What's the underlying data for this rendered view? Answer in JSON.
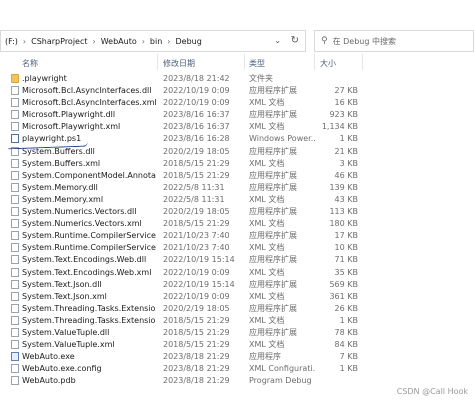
{
  "address_bar": {
    "segments": [
      "(F:)",
      "CSharpProject",
      "WebAuto",
      "bin",
      "Debug"
    ],
    "separator": "›"
  },
  "search": {
    "placeholder": "在 Debug 中搜索"
  },
  "columns": {
    "name": "名称",
    "date": "修改日期",
    "type": "类型",
    "size": "大小"
  },
  "files": [
    {
      "name": ".playwright",
      "date": "2023/8/18 21:42",
      "type": "文件夹",
      "size": "",
      "icon": "folder-icon"
    },
    {
      "name": "Microsoft.Bcl.AsyncInterfaces.dll",
      "date": "2022/10/19 0:09",
      "type": "应用程序扩展",
      "size": "27 KB",
      "icon": "dll-icon"
    },
    {
      "name": "Microsoft.Bcl.AsyncInterfaces.xml",
      "date": "2022/10/19 0:09",
      "type": "XML 文档",
      "size": "16 KB",
      "icon": "xml-icon"
    },
    {
      "name": "Microsoft.Playwright.dll",
      "date": "2023/8/16 16:37",
      "type": "应用程序扩展",
      "size": "923 KB",
      "icon": "dll-icon"
    },
    {
      "name": "Microsoft.Playwright.xml",
      "date": "2023/8/16 16:37",
      "type": "XML 文档",
      "size": "1,134 KB",
      "icon": "xml-icon"
    },
    {
      "name": "playwright.ps1",
      "date": "2023/8/16 16:28",
      "type": "Windows Power...",
      "size": "1 KB",
      "icon": "powershell-icon"
    },
    {
      "name": "System.Buffers.dll",
      "date": "2020/2/19 18:05",
      "type": "应用程序扩展",
      "size": "21 KB",
      "icon": "dll-icon"
    },
    {
      "name": "System.Buffers.xml",
      "date": "2018/5/15 21:29",
      "type": "XML 文档",
      "size": "3 KB",
      "icon": "xml-icon"
    },
    {
      "name": "System.ComponentModel.Annotation...",
      "date": "2018/5/15 21:29",
      "type": "应用程序扩展",
      "size": "46 KB",
      "icon": "dll-icon"
    },
    {
      "name": "System.Memory.dll",
      "date": "2022/5/8 11:31",
      "type": "应用程序扩展",
      "size": "139 KB",
      "icon": "dll-icon"
    },
    {
      "name": "System.Memory.xml",
      "date": "2022/5/8 11:31",
      "type": "XML 文档",
      "size": "43 KB",
      "icon": "xml-icon"
    },
    {
      "name": "System.Numerics.Vectors.dll",
      "date": "2020/2/19 18:05",
      "type": "应用程序扩展",
      "size": "113 KB",
      "icon": "dll-icon"
    },
    {
      "name": "System.Numerics.Vectors.xml",
      "date": "2018/5/15 21:29",
      "type": "XML 文档",
      "size": "180 KB",
      "icon": "xml-icon"
    },
    {
      "name": "System.Runtime.CompilerServices.Un...",
      "date": "2021/10/23 7:40",
      "type": "应用程序扩展",
      "size": "17 KB",
      "icon": "dll-icon"
    },
    {
      "name": "System.Runtime.CompilerServices.Un...",
      "date": "2021/10/23 7:40",
      "type": "XML 文档",
      "size": "10 KB",
      "icon": "xml-icon"
    },
    {
      "name": "System.Text.Encodings.Web.dll",
      "date": "2022/10/19 15:14",
      "type": "应用程序扩展",
      "size": "71 KB",
      "icon": "dll-icon"
    },
    {
      "name": "System.Text.Encodings.Web.xml",
      "date": "2022/10/19 0:09",
      "type": "XML 文档",
      "size": "35 KB",
      "icon": "xml-icon"
    },
    {
      "name": "System.Text.Json.dll",
      "date": "2022/10/19 15:14",
      "type": "应用程序扩展",
      "size": "569 KB",
      "icon": "dll-icon"
    },
    {
      "name": "System.Text.Json.xml",
      "date": "2022/10/19 0:09",
      "type": "XML 文档",
      "size": "361 KB",
      "icon": "xml-icon"
    },
    {
      "name": "System.Threading.Tasks.Extensions.dll",
      "date": "2020/2/19 18:05",
      "type": "应用程序扩展",
      "size": "26 KB",
      "icon": "dll-icon"
    },
    {
      "name": "System.Threading.Tasks.Extensions.xml",
      "date": "2018/5/15 21:29",
      "type": "XML 文档",
      "size": "1 KB",
      "icon": "xml-icon"
    },
    {
      "name": "System.ValueTuple.dll",
      "date": "2018/5/15 21:29",
      "type": "应用程序扩展",
      "size": "78 KB",
      "icon": "dll-icon"
    },
    {
      "name": "System.ValueTuple.xml",
      "date": "2018/5/15 21:29",
      "type": "XML 文档",
      "size": "84 KB",
      "icon": "xml-icon"
    },
    {
      "name": "WebAuto.exe",
      "date": "2023/8/18 21:29",
      "type": "应用程序",
      "size": "7 KB",
      "icon": "exe-icon"
    },
    {
      "name": "WebAuto.exe.config",
      "date": "2023/8/18 21:29",
      "type": "XML Configurati...",
      "size": "1 KB",
      "icon": "config-icon"
    },
    {
      "name": "WebAuto.pdb",
      "date": "2023/8/18 21:29",
      "type": "Program Debug ...",
      "size": "",
      "icon": "pdb-icon"
    }
  ],
  "watermark": "CSDN @Call Hook"
}
